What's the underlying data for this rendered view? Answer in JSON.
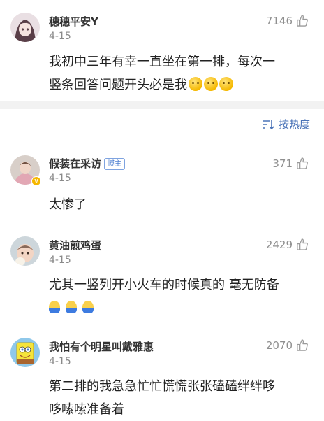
{
  "comments": [
    {
      "name": "穗穗平安Y",
      "date": "4-15",
      "likes": "7146",
      "line1": "我初中三年有幸一直坐在第一排，每次一",
      "line2": "竖条回答问题开头必是我"
    },
    {
      "name": "假装在采访",
      "badge": "博主",
      "date": "4-15",
      "likes": "371",
      "line1": "太惨了"
    },
    {
      "name": "黄油煎鸡蛋",
      "date": "4-15",
      "likes": "2429",
      "line1": "尤其一竖列开小火车的时候真的 毫无防备"
    },
    {
      "name": "我怕有个明星叫戴雅惠",
      "date": "4-15",
      "likes": "2070",
      "line1": "第二排的我急急忙忙慌慌张张磕磕绊绊哆",
      "line2": "哆嗦嗦准备着"
    }
  ],
  "sort": {
    "label": "按热度"
  },
  "icons": {
    "like": "thumbs-up-icon",
    "sort": "sort-icon",
    "vip": "verified-badge-icon"
  },
  "colors": {
    "link": "#4a73b8",
    "muted": "#8a8a8a",
    "divider": "#f2f2f2"
  }
}
